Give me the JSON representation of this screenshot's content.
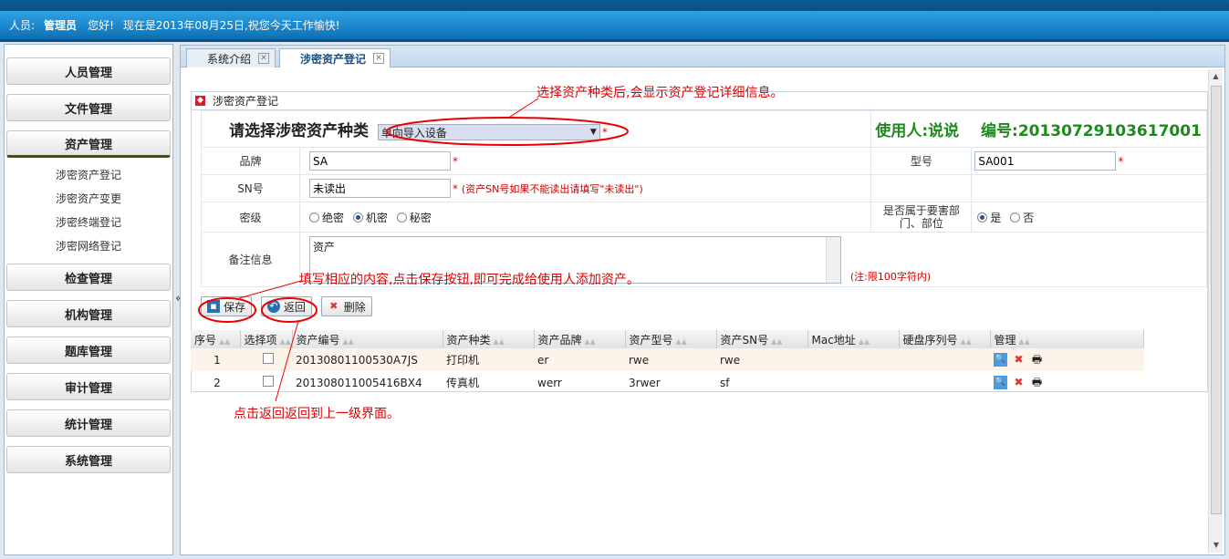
{
  "header": {
    "label": "人员:",
    "user": "管理员",
    "greeting": "您好!",
    "date_text": "现在是2013年08月25日,祝您今天工作愉快!"
  },
  "sidebar": {
    "menus": [
      "人员管理",
      "文件管理",
      "资产管理",
      "检查管理",
      "机构管理",
      "题库管理",
      "审计管理",
      "统计管理",
      "系统管理"
    ],
    "asset_sub": [
      "涉密资产登记",
      "涉密资产变更",
      "涉密终端登记",
      "涉密网络登记"
    ]
  },
  "tabs": [
    {
      "label": "系统介绍"
    },
    {
      "label": "涉密资产登记"
    }
  ],
  "form": {
    "section_title": "涉密资产登记",
    "select_label": "请选择涉密资产种类",
    "select_value": "单向导入设备",
    "user_label": "使用人:说说",
    "code_label": "编号:20130729103617001",
    "brand_label": "品牌",
    "brand_value": "SA",
    "model_label": "型号",
    "model_value": "SA001",
    "sn_label": "SN号",
    "sn_value": "未读出",
    "sn_note": "(资产SN号如果不能读出请填写\"未读出\")",
    "secret_label": "密级",
    "secret_options": [
      "绝密",
      "机密",
      "秘密"
    ],
    "secret_selected": "机密",
    "key_label": "是否属于要害部门、部位",
    "key_options": [
      "是",
      "否"
    ],
    "key_selected": "是",
    "remark_label": "备注信息",
    "remark_value": "资产",
    "remark_note": "(注:限100字符内)",
    "buttons": {
      "save": "保存",
      "back": "返回",
      "delete": "删除"
    }
  },
  "grid": {
    "headers": [
      "序号",
      "选择项",
      "资产编号",
      "资产种类",
      "资产品牌",
      "资产型号",
      "资产SN号",
      "Mac地址",
      "硬盘序列号",
      "管理"
    ],
    "rows": [
      {
        "no": "1",
        "code": "20130801100530A7JS",
        "type": "打印机",
        "brand": "er",
        "model": "rwe",
        "sn": "rwe"
      },
      {
        "no": "2",
        "code": "201308011005416BX4",
        "type": "传真机",
        "brand": "werr",
        "model": "3rwer",
        "sn": "sf"
      }
    ]
  },
  "annotations": {
    "a1": "选择资产种类后,会显示资产登记详细信息。",
    "a2": "填写相应的内容,点击保存按钮,即可完成给使用人添加资产。",
    "a3": "点击返回返回到上一级界面。"
  },
  "colors": {
    "topbar": "#1b88cf",
    "annotation": "#dd0000",
    "green_text": "#1e8a1e"
  }
}
